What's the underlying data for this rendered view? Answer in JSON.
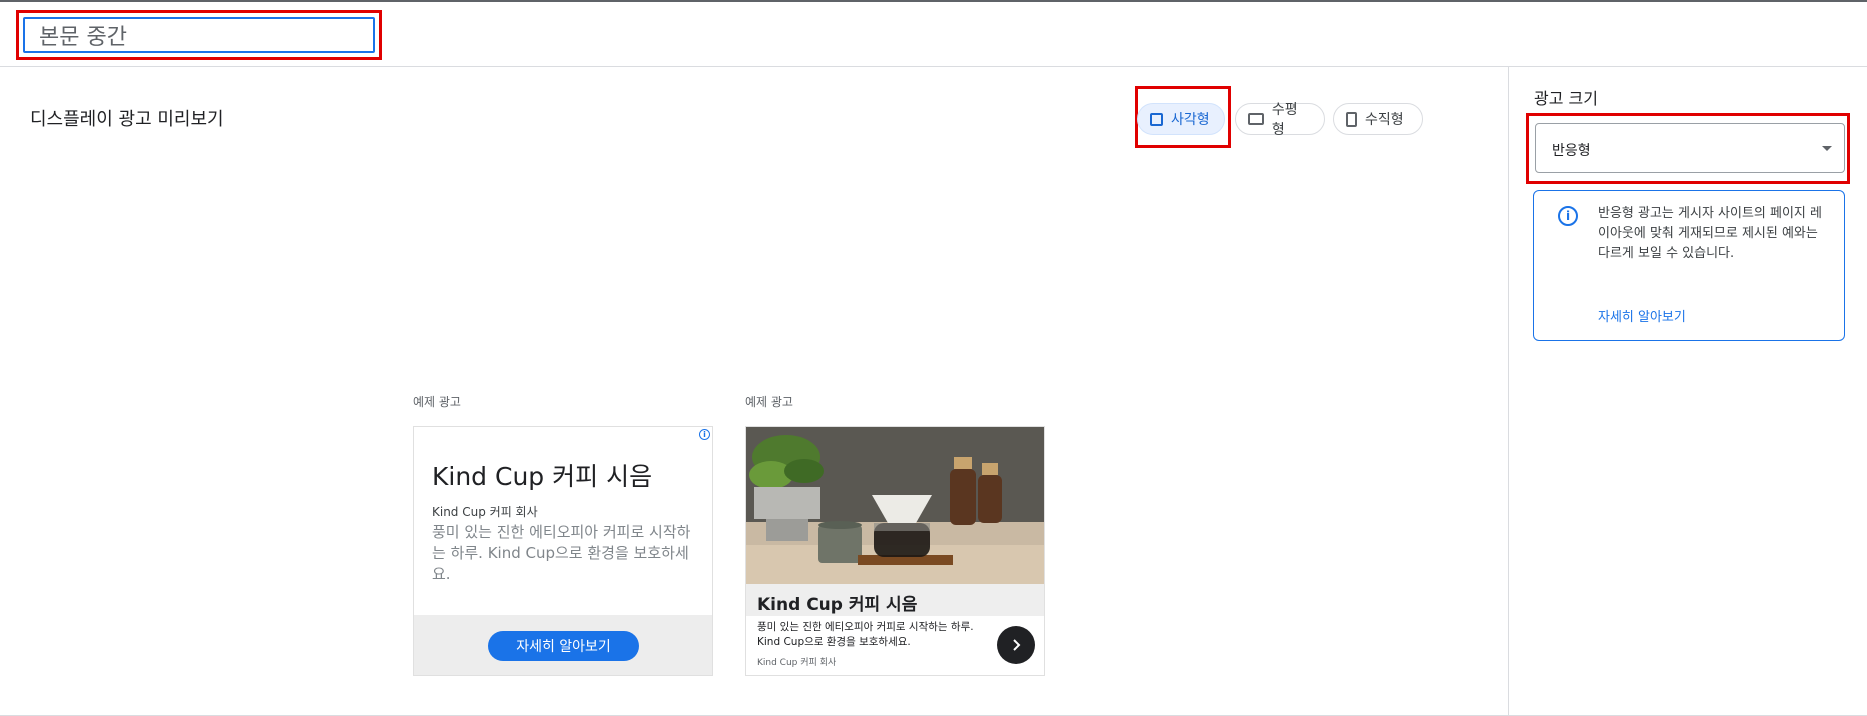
{
  "name_field": {
    "value": "본문 중간"
  },
  "preview": {
    "title": "디스플레이 광고 미리보기"
  },
  "shape_chips": [
    {
      "label": "사각형",
      "icon": "square-icon",
      "active": true
    },
    {
      "label": "수평형",
      "icon": "horizontal-rect-icon",
      "active": false
    },
    {
      "label": "수직형",
      "icon": "vertical-rect-icon",
      "active": false
    }
  ],
  "sample_ads": {
    "label": "예제 광고",
    "text_ad": {
      "info_icon": "i",
      "headline": "Kind Cup 커피 시음",
      "advertiser": "Kind Cup 커피 회사",
      "description": "풍미 있는 진한 에티오피아 커피로 시작하는 하루. Kind Cup으로 환경을 보호하세요.",
      "cta": "자세히 알아보기"
    },
    "image_ad": {
      "headline": "Kind Cup 커피 시음",
      "description": "풍미 있는 진한 에티오피아 커피로 시작하는 하루. Kind Cup으로 환경을 보호하세요.",
      "advertiser": "Kind Cup 커피 회사",
      "next_icon": "chevron-right-icon"
    }
  },
  "ad_size": {
    "label": "광고 크기",
    "selected": "반응형",
    "info": {
      "icon": "i",
      "text": "반응형 광고는 게시자 사이트의 페이지 레이아웃에 맞춰 게재되므로 제시된 예와는 다르게 보일 수 있습니다.",
      "link": "자세히 알아보기"
    }
  },
  "colors": {
    "accent": "#1a73e8",
    "highlight": "#e00000",
    "chip_active_bg": "#e8f0fe"
  }
}
